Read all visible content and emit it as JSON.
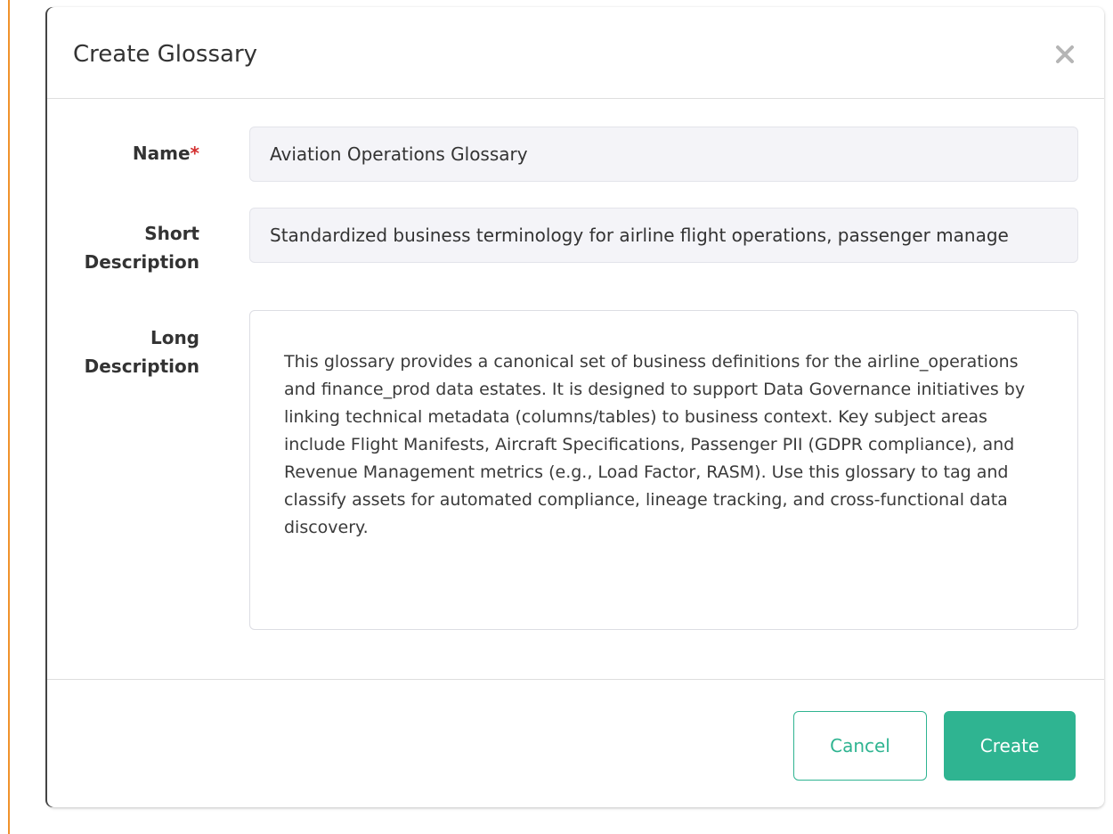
{
  "dialog": {
    "title": "Create Glossary",
    "close_label": "×"
  },
  "form": {
    "name": {
      "label": "Name",
      "required_mark": "*",
      "value": "Aviation Operations Glossary"
    },
    "short_description": {
      "label_line1": "Short",
      "label_line2": "Description",
      "value": "Standardized business terminology for airline flight operations, passenger manage"
    },
    "long_description": {
      "label_line1": "Long",
      "label_line2": "Description",
      "value": "This glossary provides a canonical set of business definitions for the airline_operations and finance_prod data estates. It is designed to support Data Governance initiatives by linking technical metadata (columns/tables) to business context. Key subject areas include Flight Manifests, Aircraft Specifications, Passenger PII (GDPR compliance), and Revenue Management metrics (e.g., Load Factor, RASM). Use this glossary to tag and classify assets for automated compliance, lineage tracking, and cross-functional data discovery."
    }
  },
  "footer": {
    "cancel_label": "Cancel",
    "create_label": "Create"
  },
  "colors": {
    "accent": "#2fb491",
    "required": "#d32f2f",
    "page_edge": "#f0922b"
  }
}
